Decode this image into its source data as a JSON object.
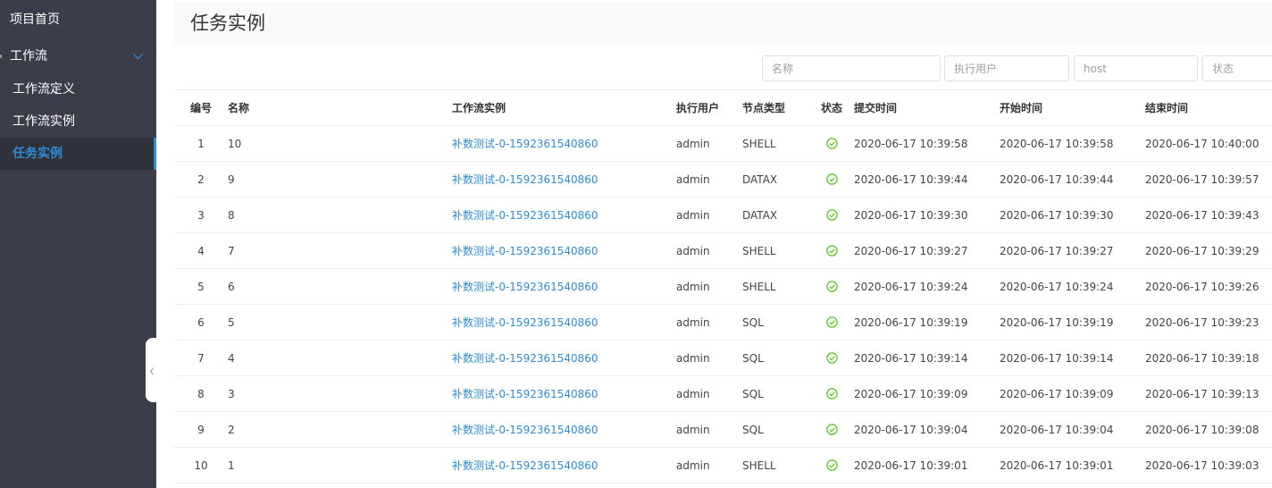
{
  "sidebar": {
    "home_label": "项目首页",
    "workflow_group_label": "工作流",
    "items": [
      {
        "label": "工作流定义"
      },
      {
        "label": "工作流实例"
      },
      {
        "label": "任务实例"
      }
    ]
  },
  "page": {
    "title": "任务实例"
  },
  "filters": {
    "name_placeholder": "名称",
    "user_placeholder": "执行用户",
    "host_placeholder": "host",
    "state_placeholder": "状态"
  },
  "table": {
    "headers": {
      "idx": "编号",
      "name": "名称",
      "workflow_instance": "工作流实例",
      "user": "执行用户",
      "node_type": "节点类型",
      "state": "状态",
      "submit_time": "提交时间",
      "start_time": "开始时间",
      "end_time": "结束时间"
    },
    "rows": [
      {
        "idx": "1",
        "name": "10",
        "workflow_instance": "补数测试-0-1592361540860",
        "user": "admin",
        "node_type": "SHELL",
        "submit_time": "2020-06-17 10:39:58",
        "start_time": "2020-06-17 10:39:58",
        "end_time": "2020-06-17 10:40:00"
      },
      {
        "idx": "2",
        "name": "9",
        "workflow_instance": "补数测试-0-1592361540860",
        "user": "admin",
        "node_type": "DATAX",
        "submit_time": "2020-06-17 10:39:44",
        "start_time": "2020-06-17 10:39:44",
        "end_time": "2020-06-17 10:39:57"
      },
      {
        "idx": "3",
        "name": "8",
        "workflow_instance": "补数测试-0-1592361540860",
        "user": "admin",
        "node_type": "DATAX",
        "submit_time": "2020-06-17 10:39:30",
        "start_time": "2020-06-17 10:39:30",
        "end_time": "2020-06-17 10:39:43"
      },
      {
        "idx": "4",
        "name": "7",
        "workflow_instance": "补数测试-0-1592361540860",
        "user": "admin",
        "node_type": "SHELL",
        "submit_time": "2020-06-17 10:39:27",
        "start_time": "2020-06-17 10:39:27",
        "end_time": "2020-06-17 10:39:29"
      },
      {
        "idx": "5",
        "name": "6",
        "workflow_instance": "补数测试-0-1592361540860",
        "user": "admin",
        "node_type": "SHELL",
        "submit_time": "2020-06-17 10:39:24",
        "start_time": "2020-06-17 10:39:24",
        "end_time": "2020-06-17 10:39:26"
      },
      {
        "idx": "6",
        "name": "5",
        "workflow_instance": "补数测试-0-1592361540860",
        "user": "admin",
        "node_type": "SQL",
        "submit_time": "2020-06-17 10:39:19",
        "start_time": "2020-06-17 10:39:19",
        "end_time": "2020-06-17 10:39:23"
      },
      {
        "idx": "7",
        "name": "4",
        "workflow_instance": "补数测试-0-1592361540860",
        "user": "admin",
        "node_type": "SQL",
        "submit_time": "2020-06-17 10:39:14",
        "start_time": "2020-06-17 10:39:14",
        "end_time": "2020-06-17 10:39:18"
      },
      {
        "idx": "8",
        "name": "3",
        "workflow_instance": "补数测试-0-1592361540860",
        "user": "admin",
        "node_type": "SQL",
        "submit_time": "2020-06-17 10:39:09",
        "start_time": "2020-06-17 10:39:09",
        "end_time": "2020-06-17 10:39:13"
      },
      {
        "idx": "9",
        "name": "2",
        "workflow_instance": "补数测试-0-1592361540860",
        "user": "admin",
        "node_type": "SQL",
        "submit_time": "2020-06-17 10:39:04",
        "start_time": "2020-06-17 10:39:04",
        "end_time": "2020-06-17 10:39:08"
      },
      {
        "idx": "10",
        "name": "1",
        "workflow_instance": "补数测试-0-1592361540860",
        "user": "admin",
        "node_type": "SHELL",
        "submit_time": "2020-06-17 10:39:01",
        "start_time": "2020-06-17 10:39:01",
        "end_time": "2020-06-17 10:39:03"
      }
    ]
  },
  "icons": {
    "state": "success-check-circle-icon",
    "group_toggle": "chevron-down-icon",
    "collapse": "chevron-left-icon"
  },
  "colors": {
    "accent": "#2f8bd6",
    "success": "#52c41a",
    "sidebar_bg": "#3b3e48"
  }
}
